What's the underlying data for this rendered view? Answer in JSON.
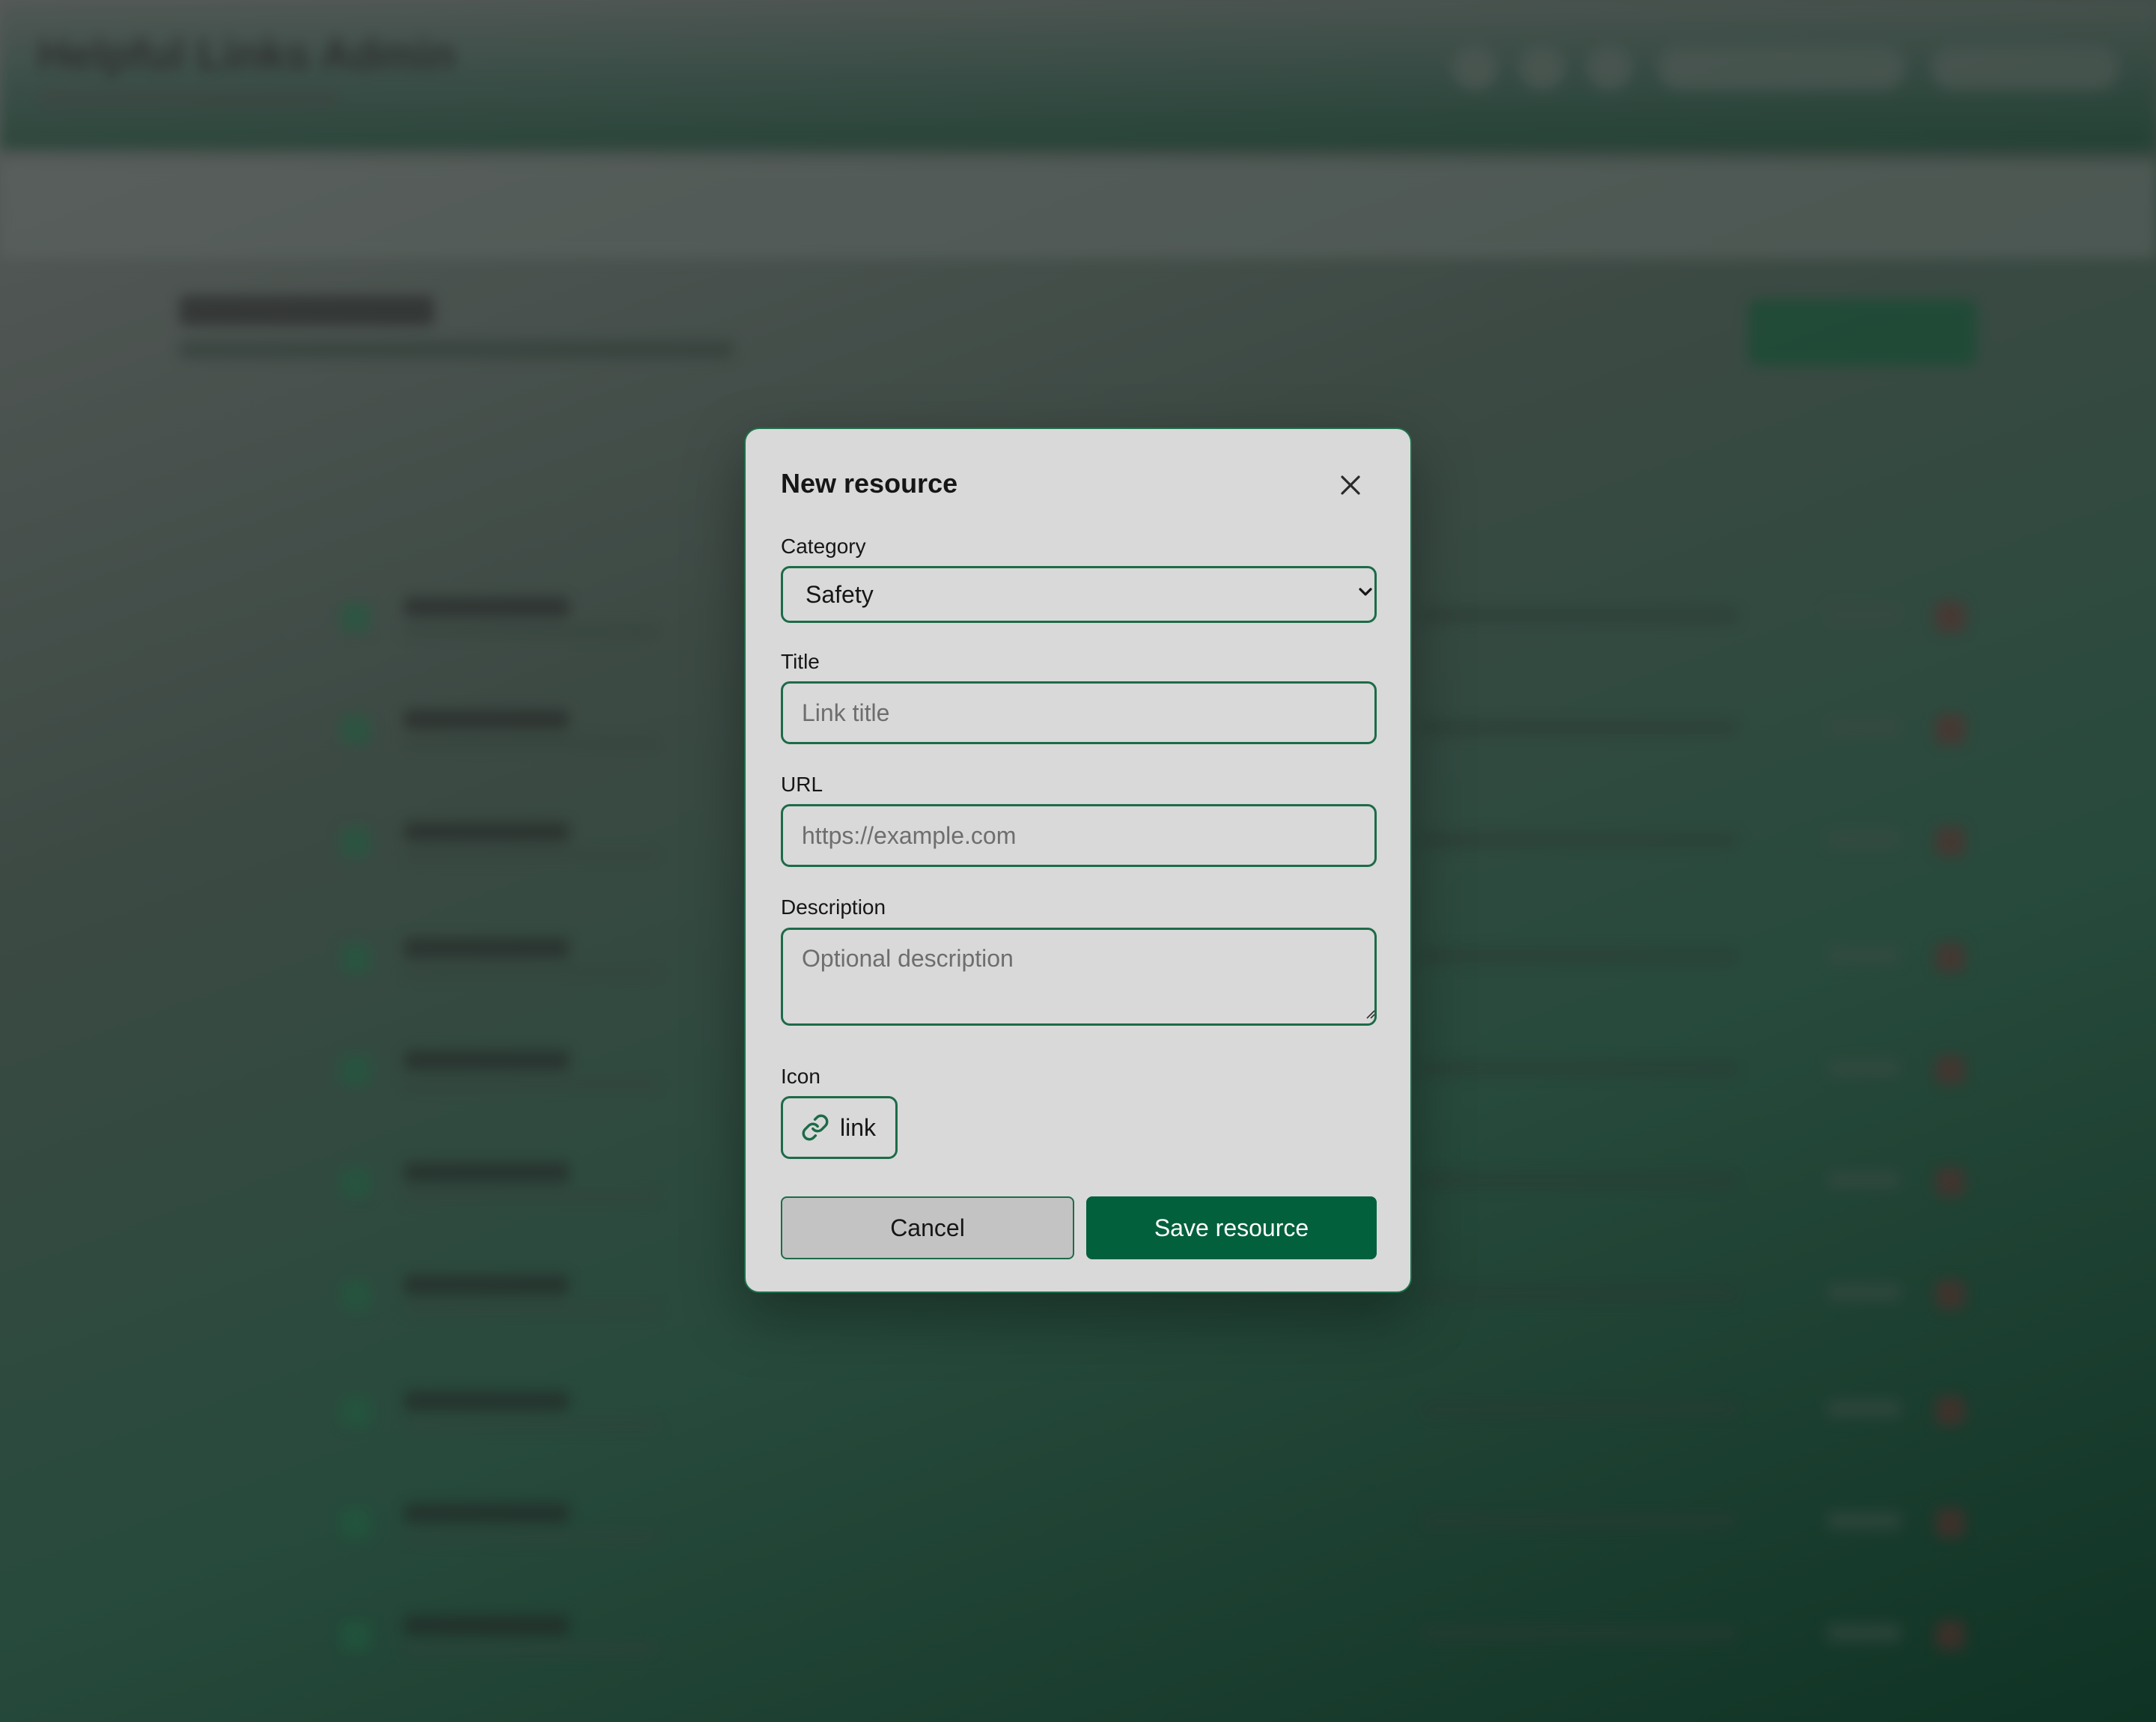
{
  "background": {
    "app_title": "Helpful Links Admin"
  },
  "modal": {
    "title": "New resource",
    "close_icon": "close-icon",
    "category": {
      "label": "Category",
      "selected": "Safety"
    },
    "title_field": {
      "label": "Title",
      "value": "",
      "placeholder": "Link title"
    },
    "url_field": {
      "label": "URL",
      "value": "",
      "placeholder": "https://example.com"
    },
    "description_field": {
      "label": "Description",
      "value": "",
      "placeholder": "Optional description"
    },
    "icon_field": {
      "label": "Icon",
      "icon": "link-icon",
      "value": "link"
    },
    "cancel_label": "Cancel",
    "save_label": "Save resource"
  },
  "colors": {
    "accent": "#03603d",
    "border": "#1d6b48",
    "modal_bg": "#d9d9d9",
    "cancel_bg": "#c3c3c3"
  }
}
